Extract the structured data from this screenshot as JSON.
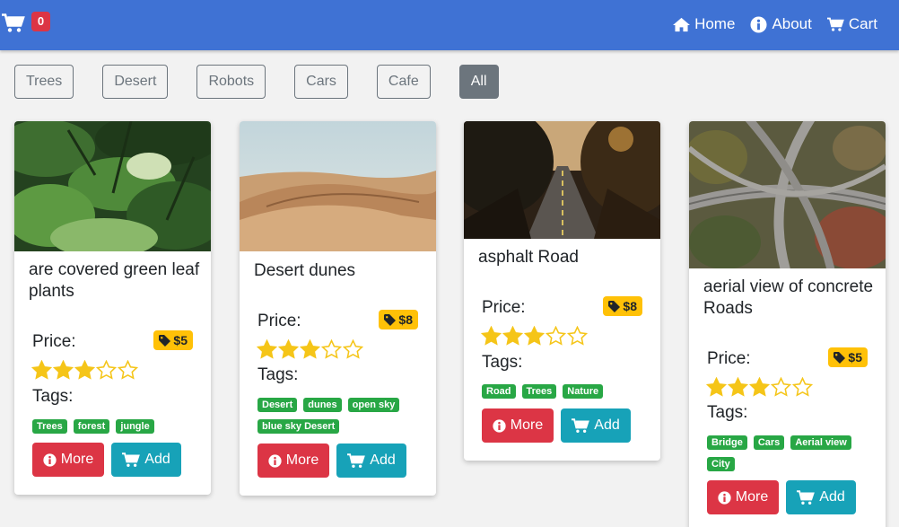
{
  "header": {
    "cart_count": "0",
    "nav": [
      {
        "label": "Home",
        "icon": "home-icon"
      },
      {
        "label": "About",
        "icon": "info-icon"
      },
      {
        "label": "Cart",
        "icon": "cart-icon"
      }
    ]
  },
  "filters": [
    "Trees",
    "Desert",
    "Robots",
    "Cars",
    "Cafe",
    "All"
  ],
  "active_filter": "All",
  "products": [
    {
      "title": "are covered green leaf plants",
      "price_label": "Price:",
      "price": "$5",
      "rating": 3,
      "rating_max": 5,
      "tags_label": "Tags:",
      "tags": [
        "Trees",
        "forest",
        "jungle"
      ],
      "more_label": "More",
      "add_label": "Add"
    },
    {
      "title": "Desert dunes",
      "price_label": "Price:",
      "price": "$8",
      "rating": 3,
      "rating_max": 5,
      "tags_label": "Tags:",
      "tags": [
        "Desert",
        "dunes",
        "open sky",
        "blue sky Desert"
      ],
      "more_label": "More",
      "add_label": "Add"
    },
    {
      "title": "asphalt Road",
      "price_label": "Price:",
      "price": "$8",
      "rating": 3,
      "rating_max": 5,
      "tags_label": "Tags:",
      "tags": [
        "Road",
        "Trees",
        "Nature"
      ],
      "more_label": "More",
      "add_label": "Add"
    },
    {
      "title": "aerial view of concrete Roads",
      "price_label": "Price:",
      "price": "$5",
      "rating": 3,
      "rating_max": 5,
      "tags_label": "Tags:",
      "tags": [
        "Bridge",
        "Cars",
        "Aerial view",
        "City"
      ],
      "more_label": "More",
      "add_label": "Add"
    }
  ],
  "colors": {
    "navbar": "#3f72d4",
    "badge": "#dc3545",
    "price_badge": "#ffc107",
    "tag": "#28a745",
    "more_button": "#dc3545",
    "add_button": "#17a2b8",
    "star": "#f5c518"
  }
}
